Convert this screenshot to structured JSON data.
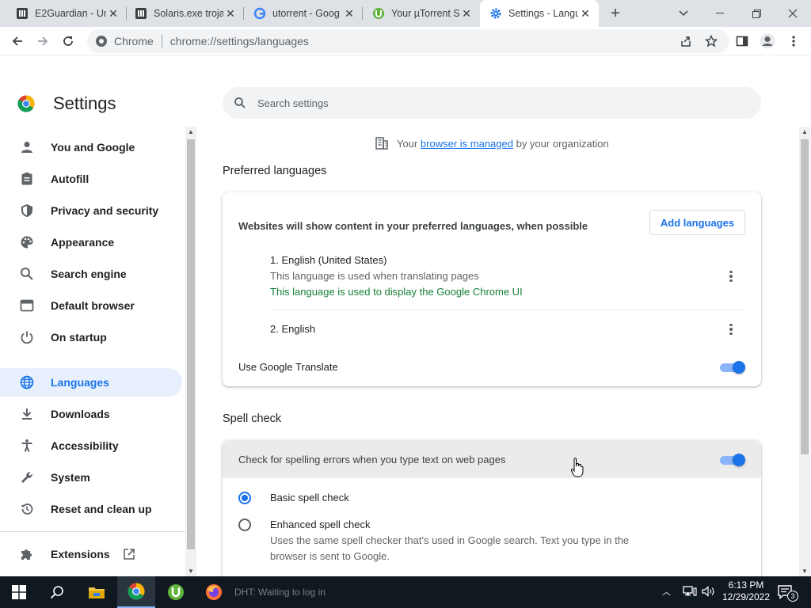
{
  "browser": {
    "tabs": [
      {
        "title": "E2Guardian - Ur",
        "favicon": "e2guardian-icon"
      },
      {
        "title": "Solaris.exe troja",
        "favicon": "document-icon"
      },
      {
        "title": "utorrent - Goog",
        "favicon": "google-icon"
      },
      {
        "title": "Your µTorrent S",
        "favicon": "utorrent-icon"
      },
      {
        "title": "Settings - Langu",
        "favicon": "gear-icon",
        "active": true
      }
    ],
    "omnibox": {
      "chip": "Chrome",
      "url": "chrome://settings/languages"
    }
  },
  "settings": {
    "title": "Settings",
    "search_placeholder": "Search settings",
    "nav": [
      {
        "label": "You and Google",
        "icon": "person-icon"
      },
      {
        "label": "Autofill",
        "icon": "clipboard-icon"
      },
      {
        "label": "Privacy and security",
        "icon": "shield-icon"
      },
      {
        "label": "Appearance",
        "icon": "palette-icon"
      },
      {
        "label": "Search engine",
        "icon": "search-icon"
      },
      {
        "label": "Default browser",
        "icon": "browser-icon"
      },
      {
        "label": "On startup",
        "icon": "power-icon"
      },
      {
        "label": "Languages",
        "icon": "globe-icon",
        "selected": true
      },
      {
        "label": "Downloads",
        "icon": "download-icon"
      },
      {
        "label": "Accessibility",
        "icon": "accessibility-icon"
      },
      {
        "label": "System",
        "icon": "wrench-icon"
      },
      {
        "label": "Reset and clean up",
        "icon": "history-icon"
      },
      {
        "label": "Extensions",
        "icon": "puzzle-icon"
      }
    ]
  },
  "main": {
    "managed": {
      "prefix": "Your",
      "link": "browser is managed",
      "suffix": "by your organization"
    },
    "preferred": {
      "title": "Preferred languages",
      "description": "Websites will show content in your preferred languages, when possible",
      "add_button": "Add languages",
      "languages": [
        {
          "name": "1. English (United States)",
          "sub": "This language is used when translating pages",
          "ui_note": "This language is used to display the Google Chrome UI"
        },
        {
          "name": "2. English"
        }
      ],
      "translate_label": "Use Google Translate",
      "translate_on": true
    },
    "spell": {
      "title": "Spell check",
      "toggle_label": "Check for spelling errors when you type text on web pages",
      "toggle_on": true,
      "basic": "Basic spell check",
      "enhanced": "Enhanced spell check",
      "enhanced_desc_1": "Uses the same spell checker that's used in Google search. Text you type in the",
      "enhanced_desc_2": "browser is sent to Google.",
      "selected": "basic"
    }
  },
  "taskbar": {
    "status_text": "DHT: Waiting to log in",
    "time": "6:13 PM",
    "date": "12/29/2022",
    "notifications": "3"
  }
}
